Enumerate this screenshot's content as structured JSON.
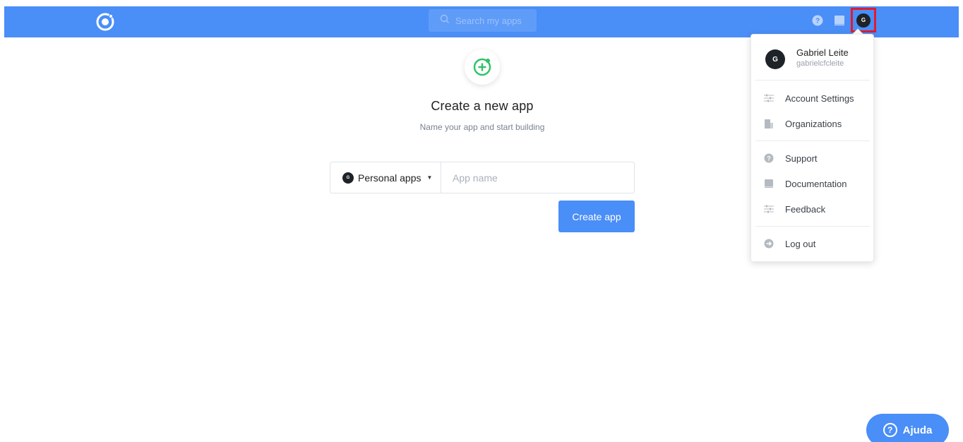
{
  "topbar": {
    "logo_icon": "ionic-logo-icon",
    "search_placeholder": "Search my apps",
    "avatar_initial": "G",
    "bar_color": "#4a8ef7"
  },
  "main": {
    "title": "Create a new app",
    "subtitle": "Name your app and start building",
    "org_initial": "G",
    "org_label": "Personal apps",
    "app_name_placeholder": "App name",
    "create_button": "Create app",
    "plus_color": "#2dc268"
  },
  "account_menu": {
    "avatar_initial": "G",
    "name": "Gabriel Leite",
    "handle": "gabrielcfcleite",
    "items": [
      {
        "label": "Account Settings",
        "icon": "sliders-icon"
      },
      {
        "label": "Organizations",
        "icon": "building-icon"
      },
      {
        "label": "Support",
        "icon": "question-circle-icon"
      },
      {
        "label": "Documentation",
        "icon": "book-icon"
      },
      {
        "label": "Feedback",
        "icon": "sliders-icon"
      },
      {
        "label": "Log out",
        "icon": "arrow-right-circle-icon"
      }
    ]
  },
  "help_widget": {
    "label": "Ajuda"
  }
}
